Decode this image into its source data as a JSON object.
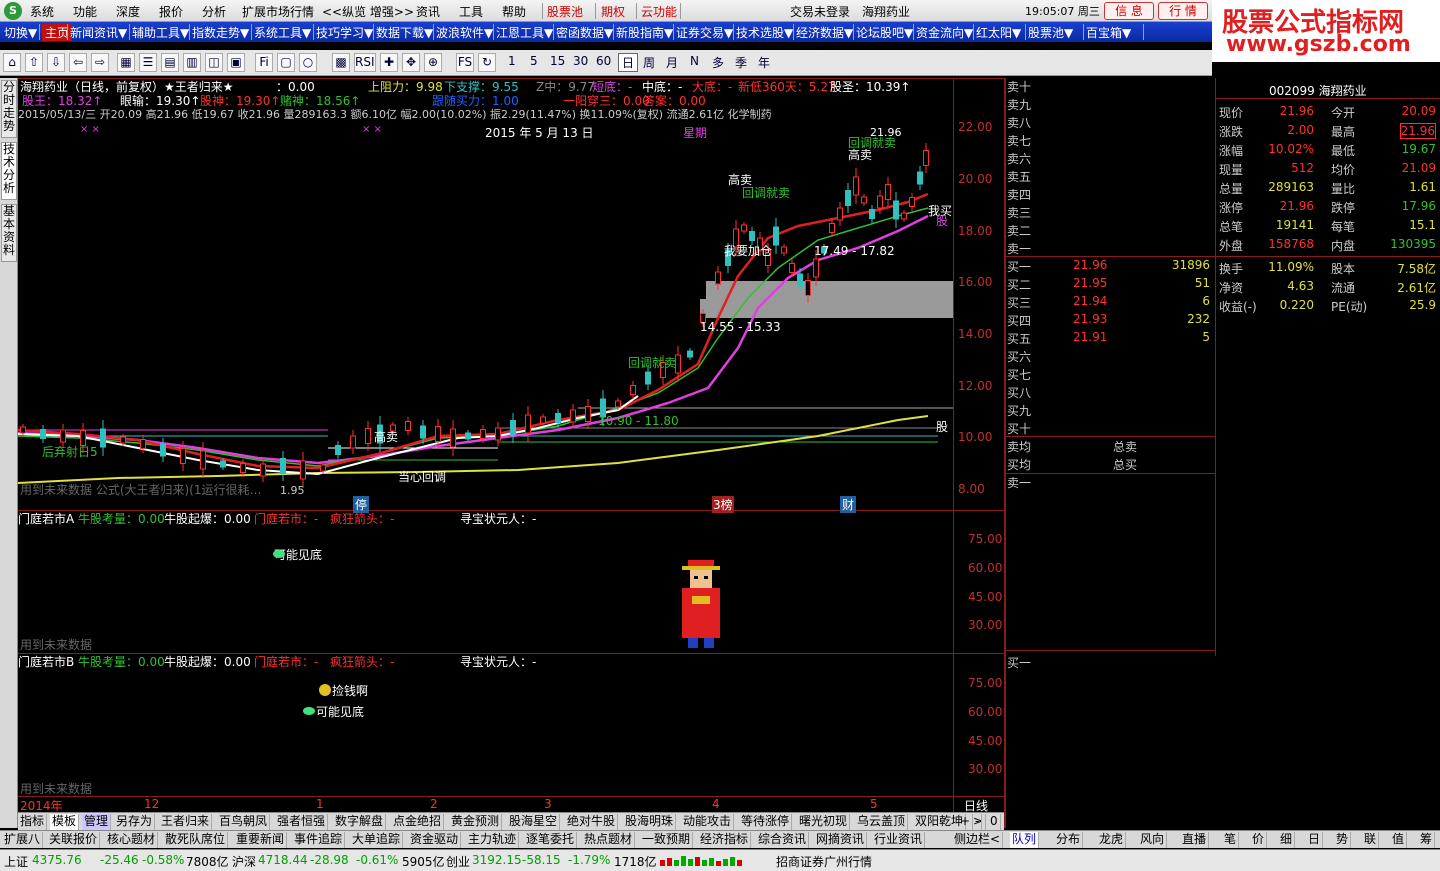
{
  "menu": {
    "items": [
      "系统",
      "功能",
      "深度",
      "报价",
      "分析",
      "扩展市场行情",
      "<<纵览 增强>>",
      "资讯",
      "工具",
      "帮助",
      "股票池",
      "期权",
      "云功能"
    ],
    "trade_status": "交易未登录",
    "stock_name": "海翔药业",
    "clock": "19:05:07 周三",
    "btn_info": "信 息",
    "btn_quote": "行 情"
  },
  "watermark": {
    "line1": "股票公式指标网",
    "line2": "www.gszb.com"
  },
  "navbar": [
    "切换▼",
    "主页",
    "新闻资讯▼",
    "辅助工具▼",
    "指数走势▼",
    "系统工具▼",
    "技巧学习▼",
    "数据下载▼",
    "波浪软件▼",
    "江恩工具▼",
    "密函数据▼",
    "新股指南▼",
    "证券交易▼",
    "技术选股▼",
    "经济数据▼",
    "论坛股吧▼",
    "资金流向▼",
    "红太阳▼",
    "股票池▼",
    "百宝箱▼"
  ],
  "toolbar": {
    "periods": [
      "1",
      "5",
      "15",
      "30",
      "60",
      "日",
      "周",
      "月",
      "N",
      "多",
      "季",
      "年"
    ],
    "selected_period": "日",
    "rsi": "RSI",
    "fs": "FS"
  },
  "left_tabs": [
    "分时走势",
    "技术分析",
    "基本资料"
  ],
  "chart": {
    "header1": {
      "name": "海翔药业（日线，前复权）★王者归来★",
      "val": "：0.00",
      "up_res": "上阻力：9.98",
      "down_sup": "下支撑：9.55",
      "z_mid": "Z中：9.77",
      "short_bottom": "短底：-",
      "mid_bottom": "中底：-",
      "big_bottom": "大底：-",
      "new_low": "新低360天：5.27",
      "stock_saint": "股圣：10.39↑"
    },
    "header2": {
      "king": "股王：18.32↑",
      "eye": "眼输：19.30↑",
      "soul": "股神：19.30↑",
      "gamble": "赌神：18.56↑",
      "follow": "跟随买力：1.00",
      "yang": "一阳穿三：0.00",
      "answer": "答案：0.00"
    },
    "header3": "2015/05/13/三 开20.09 高21.96 低19.67 收21.96 量289163.3 额6.10亿 幅2.00(10.02%) 振2.29(11.47%) 换11.09%(复权) 流通2.61亿 化学制药",
    "date_label": "2015 年 5 月 13 日",
    "week_label": "星期",
    "y_axis": [
      "22.00",
      "20.00",
      "18.00",
      "16.00",
      "14.00",
      "12.00",
      "10.00",
      "8.00"
    ],
    "annotations": {
      "sell_high1": "高卖",
      "pullback1": "回调就卖",
      "buy_add": "我要加仓",
      "sell_high2": "高卖",
      "pullback2": "回调就卖",
      "range1": "17.49 - 17.82",
      "range2": "14.55 - 15.33",
      "range3": "10.90 - 11.80",
      "pullback3": "回调就卖",
      "sell_high3": "高卖",
      "reenter": "后弃射日5",
      "bottom_ctrl": "当心回调",
      "max_label": "21.96",
      "buy_label": "我买",
      "gu_label": "股",
      "shou_label": "股",
      "low_label": "1.95",
      "future1": "用到未来数据  公式(大王者归来)(1运行很耗…",
      "marker_ting": "停",
      "marker_3": "3榜",
      "marker_cai": "财",
      "xx": "× ×"
    },
    "panel_a": {
      "title": "门庭若市A",
      "t1": "牛股考量：0.00",
      "t2": "牛股起爆：0.00",
      "t3": "门庭若市：-",
      "t4": "疯狂箭头：-",
      "t5": "寻宝状元人：-",
      "bottom_hint": "可能见底",
      "future": "用到未来数据",
      "y": [
        "75.00",
        "60.00",
        "45.00",
        "30.00"
      ]
    },
    "panel_b": {
      "title": "门庭若市B",
      "t1": "牛股考量：0.00",
      "t2": "牛股起爆：0.00",
      "t3": "门庭若市：-",
      "t4": "疯狂箭头：-",
      "t5": "寻宝状元人：-",
      "money": "捡钱啊",
      "bottom_hint": "可能见底",
      "future": "用到未来数据",
      "y": [
        "75.00",
        "60.00",
        "45.00",
        "30.00"
      ]
    },
    "x_axis": {
      "year": "2014年",
      "m12": "12",
      "m1": "1",
      "m2": "2",
      "m3": "3",
      "m4": "4",
      "m5": "5",
      "period": "日线"
    }
  },
  "quote": {
    "code_name": "002099 海翔药业",
    "sell_labels": [
      "卖十",
      "卖九",
      "卖八",
      "卖七",
      "卖六",
      "卖五",
      "卖四",
      "卖三",
      "卖二",
      "卖一"
    ],
    "buy_labels": [
      "买一",
      "买二",
      "买三",
      "买四",
      "买五",
      "买六",
      "买七",
      "买八",
      "买九",
      "买十"
    ],
    "buy_prices": [
      "21.96",
      "21.95",
      "21.94",
      "21.93",
      "21.91"
    ],
    "buy_vols": [
      "31896",
      "51",
      "6",
      "232",
      "5"
    ],
    "avg_sell": "卖均",
    "avg_buy": "买均",
    "total_sell": "总卖",
    "total_buy": "总买",
    "sell_one_box": "卖一",
    "buy_one_box": "买一",
    "stats": [
      [
        "现价",
        "21.96",
        "今开",
        "20.09"
      ],
      [
        "涨跌",
        "2.00",
        "最高",
        "21.96"
      ],
      [
        "涨幅",
        "10.02%",
        "最低",
        "19.67"
      ],
      [
        "现量",
        "512",
        "均价",
        "21.09"
      ],
      [
        "总量",
        "289163",
        "量比",
        "1.61"
      ],
      [
        "涨停",
        "21.96",
        "跌停",
        "17.96"
      ],
      [
        "总笔",
        "19141",
        "每笔",
        "15.1"
      ],
      [
        "外盘",
        "158768",
        "内盘",
        "130395"
      ]
    ],
    "stats2": [
      [
        "换手",
        "11.09%",
        "股本",
        "7.58亿"
      ],
      [
        "净资",
        "4.63",
        "流通",
        "2.61亿"
      ],
      [
        "收益(-)",
        "0.220",
        "PE(动)",
        "25.9"
      ]
    ]
  },
  "tabs1": [
    "指标",
    "模板",
    "管理",
    "另存为",
    "王者归来",
    "百鸟朝凤",
    "强者恒强",
    "数字解盘",
    "点金绝招",
    "黄金预测",
    "股海星空",
    "绝对牛股",
    "股海明珠",
    "动能攻击",
    "等待涨停",
    "曙光初现",
    "乌云盖顶",
    "双阳乾坤",
    ">"
  ],
  "tabs1_extra": [
    "+",
    "-",
    "0"
  ],
  "tabs2": [
    "扩展八",
    "关联报价",
    "核心题材",
    "散死队席位",
    "重要新闻",
    "事件追踪",
    "大单追踪",
    "资金驱动",
    "主力轨迹",
    "逐笔委托",
    "热点题材",
    "一致预期",
    "经济指标",
    "综合资讯",
    "网摘资讯",
    "行业资讯",
    "侧边栏<"
  ],
  "tabs2_right": [
    "队列",
    "分布",
    "龙虎",
    "风向",
    "直播",
    "笔",
    "价",
    "细",
    "日",
    "势",
    "联",
    "值",
    "筹"
  ],
  "status": {
    "sh": "上证",
    "sh_val": "4375.76",
    "sh_chg": "-25.46",
    "sh_pct": "-0.58%",
    "sh_amt": "7808亿",
    "hs": "沪深",
    "hs_val": "4718.44",
    "hs_chg": "-28.98",
    "hs_pct": "-0.61%",
    "hs_amt": "5905亿",
    "cy": "创业",
    "cy_val": "3192.15",
    "cy_chg": "-58.15",
    "cy_pct": "-1.79%",
    "cy_amt": "1718亿",
    "broker": "招商证券广州行情"
  },
  "colors": {
    "up": "#ff3030",
    "down": "#30c0c0",
    "ma_red": "#e02020",
    "ma_mag": "#e040e0",
    "ma_yel": "#e0e040",
    "ma_green": "#30c030"
  }
}
